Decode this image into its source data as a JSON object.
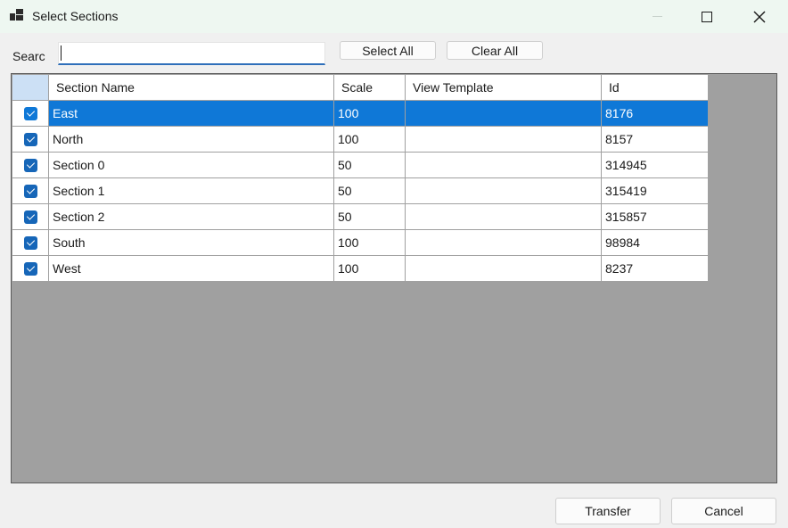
{
  "window": {
    "title": "Select Sections"
  },
  "search": {
    "label": "Searc",
    "value": "",
    "placeholder": ""
  },
  "toolbar": {
    "select_all_label": "Select All",
    "clear_all_label": "Clear All"
  },
  "grid": {
    "columns": [
      "Section Name",
      "Scale",
      "View Template",
      "Id"
    ],
    "rows": [
      {
        "checked": true,
        "name": "East",
        "scale": "100",
        "view_template": "",
        "id": "8176",
        "selected": true
      },
      {
        "checked": true,
        "name": "North",
        "scale": "100",
        "view_template": "",
        "id": "8157",
        "selected": false
      },
      {
        "checked": true,
        "name": "Section 0",
        "scale": "50",
        "view_template": "",
        "id": "314945",
        "selected": false
      },
      {
        "checked": true,
        "name": "Section 1",
        "scale": "50",
        "view_template": "",
        "id": "315419",
        "selected": false
      },
      {
        "checked": true,
        "name": "Section 2",
        "scale": "50",
        "view_template": "",
        "id": "315857",
        "selected": false
      },
      {
        "checked": true,
        "name": "South",
        "scale": "100",
        "view_template": "",
        "id": "98984",
        "selected": false
      },
      {
        "checked": true,
        "name": "West",
        "scale": "100",
        "view_template": "",
        "id": "8237",
        "selected": false
      }
    ]
  },
  "footer": {
    "transfer_label": "Transfer",
    "cancel_label": "Cancel"
  },
  "icons": {
    "app": "app-windows-icon",
    "minimize": "minimize-icon",
    "maximize": "maximize-icon",
    "close": "close-icon",
    "checkbox": "checkbox-checked-icon"
  },
  "colors": {
    "selection": "#0f78d7",
    "checkbox": "#1666b8",
    "titlebar": "#eef7f1",
    "grid_background": "#a0a0a0"
  }
}
